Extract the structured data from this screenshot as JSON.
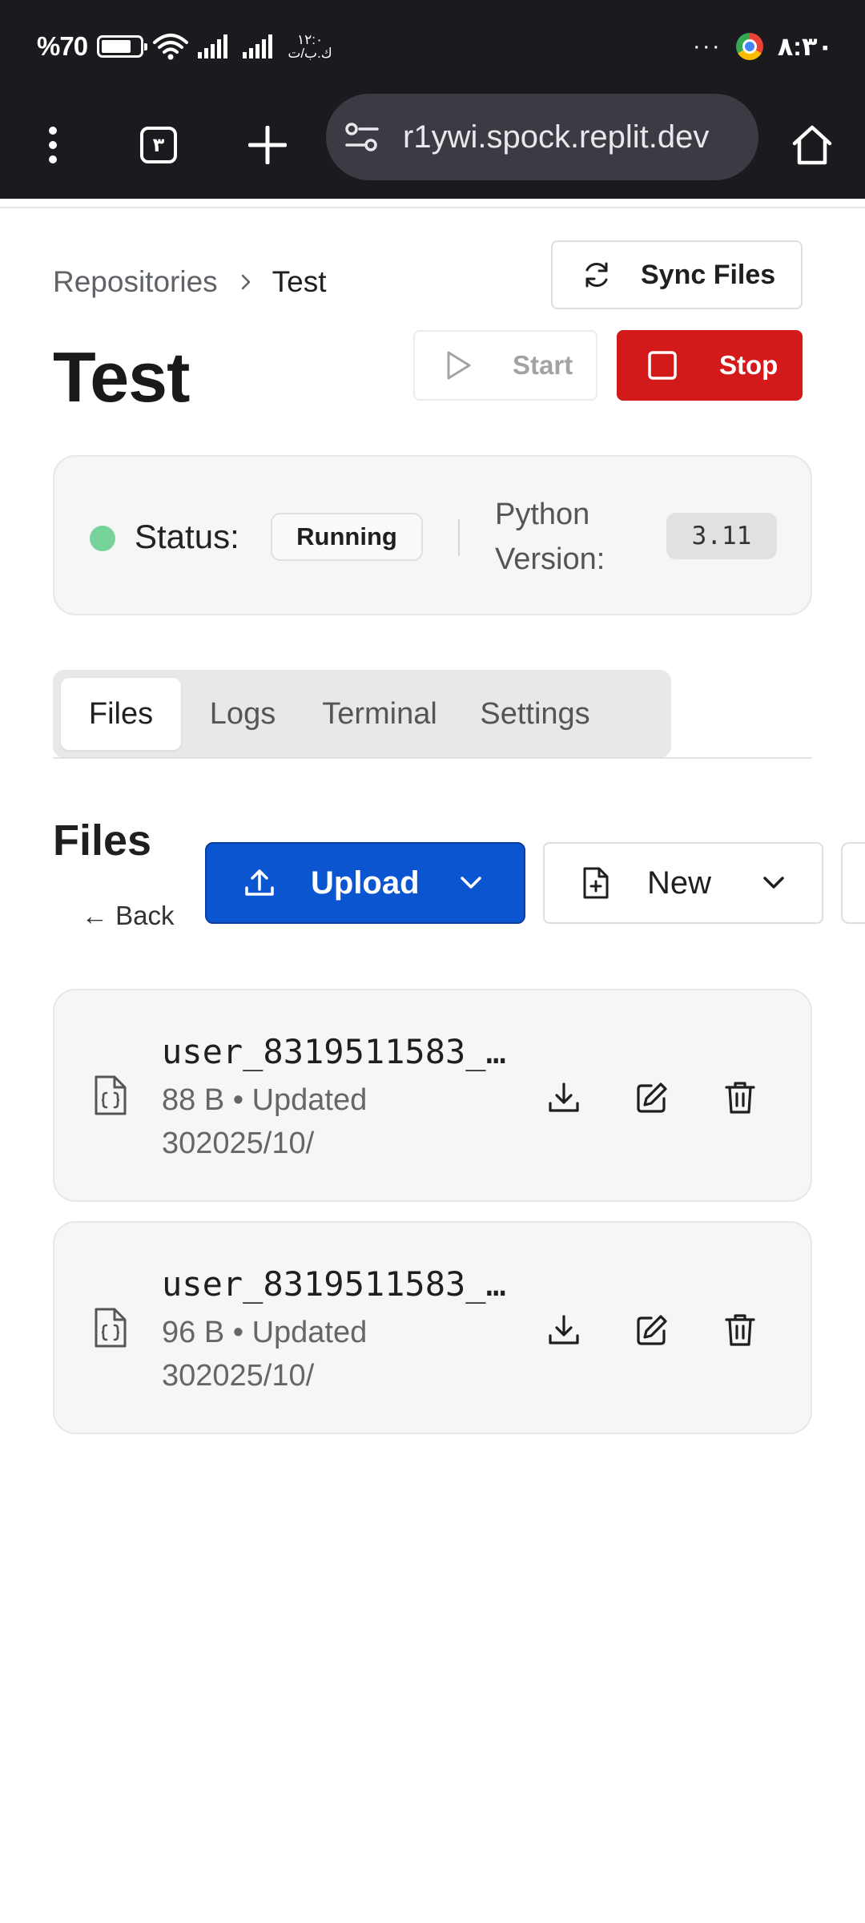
{
  "status_bar": {
    "battery_text": "%70",
    "carrier_text": "۱۲:۰\nك.ب/ت",
    "overflow_dots": "···",
    "time": "۸:۳۰"
  },
  "browser": {
    "tab_count": "۳",
    "url": "r1ywi.spock.replit.dev"
  },
  "breadcrumb": {
    "parent": "Repositories",
    "current": "Test"
  },
  "actions": {
    "sync_label": "Sync Files",
    "start_label": "Start",
    "stop_label": "Stop"
  },
  "page": {
    "title": "Test"
  },
  "status_card": {
    "status_label": "Status:",
    "status_value": "Running",
    "python_label": "Python Version:",
    "python_value": "3.11",
    "status_color": "#77d39a"
  },
  "tabs": [
    {
      "label": "Files",
      "active": true
    },
    {
      "label": "Logs",
      "active": false
    },
    {
      "label": "Terminal",
      "active": false
    },
    {
      "label": "Settings",
      "active": false
    }
  ],
  "files_section": {
    "heading": "Files",
    "back_label": "← Back",
    "upload_label": "Upload",
    "new_label": "New"
  },
  "files": [
    {
      "name": "user_8319511583_…",
      "meta": "88 B • Updated 302025/10/"
    },
    {
      "name": "user_8319511583_…",
      "meta": "96 B • Updated 302025/10/"
    }
  ],
  "colors": {
    "stop_red": "#d4191b",
    "upload_blue": "#0b55d1",
    "chrome_bar": "#1b1b1f"
  }
}
